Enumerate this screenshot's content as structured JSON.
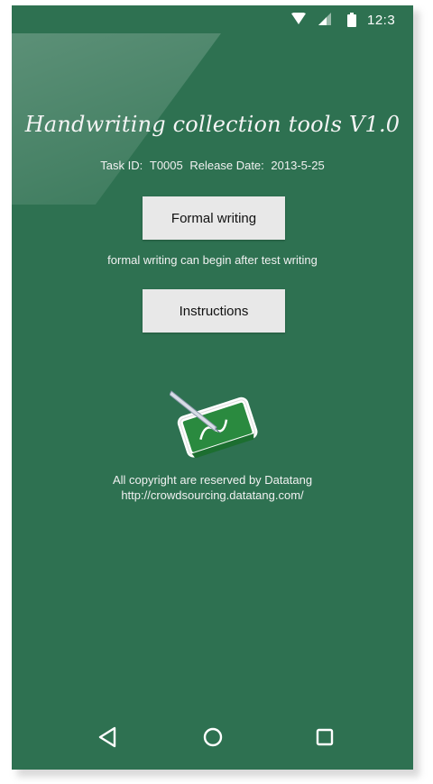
{
  "status_bar": {
    "time": "12:3",
    "icons": [
      "wifi-icon",
      "cell-signal-icon",
      "battery-icon"
    ]
  },
  "app": {
    "title": "Handwriting collection tools V1.0",
    "task_id_label": "Task ID:",
    "task_id": "T0005",
    "release_date_label": "Release Date:",
    "release_date": "2013-5-25"
  },
  "buttons": {
    "formal_writing": "Formal writing",
    "instructions": "Instructions"
  },
  "hint": "formal writing can begin after test writing",
  "logo_icon": "tablet-pen-icon",
  "copyright": {
    "line1": "All copyright are reserved by Datatang",
    "line2": "http://crowdsourcing.datatang.com/"
  },
  "navigation_bar": {
    "icons": [
      "back-icon",
      "home-icon",
      "recents-icon"
    ]
  },
  "colors": {
    "background": "#2e7151",
    "button": "#e8e8e8",
    "text": "#f1f1f1"
  }
}
